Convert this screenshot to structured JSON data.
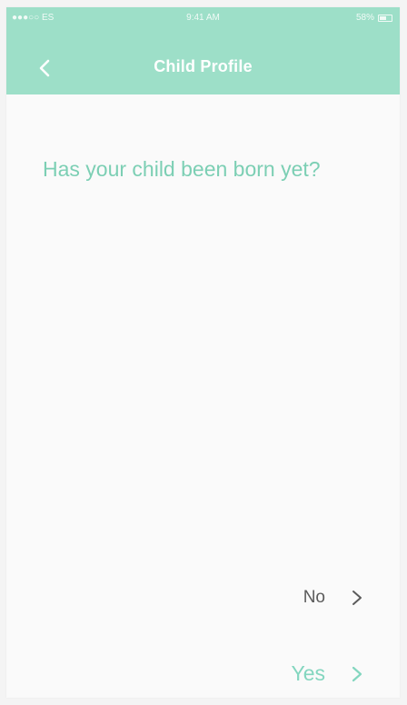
{
  "status_bar": {
    "carrier": "●●●○○ ES",
    "time": "9:41 AM",
    "battery": "58%"
  },
  "header": {
    "title": "Child Profile",
    "back_icon": "chevron-left-icon"
  },
  "question": {
    "text": "Has your child been born yet?"
  },
  "answers": {
    "no": {
      "label": "No",
      "icon": "chevron-right-icon"
    },
    "yes": {
      "label": "Yes",
      "icon": "chevron-right-icon"
    }
  },
  "colors": {
    "header_bg": "#9ddfc8",
    "accent": "#7ccfb4",
    "text_dark": "#5b5b5b",
    "background": "#fafafa"
  }
}
